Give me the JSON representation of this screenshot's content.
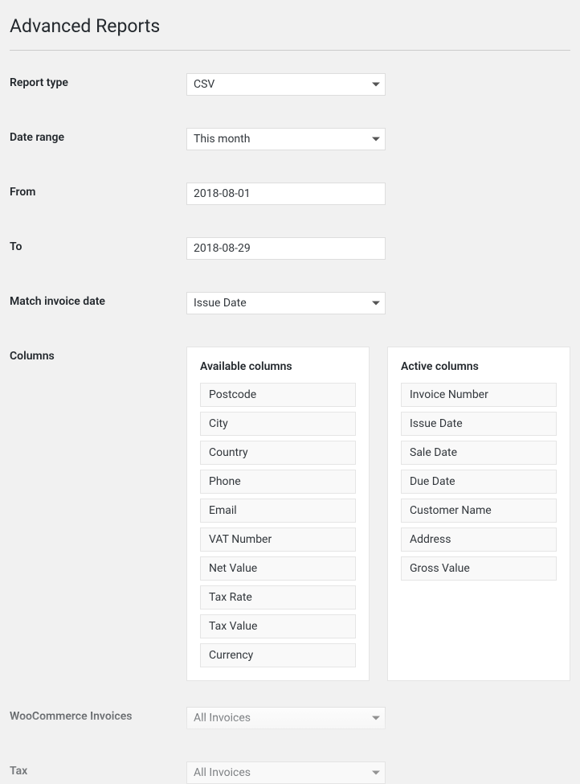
{
  "page_title": "Advanced Reports",
  "fields": {
    "report_type": {
      "label": "Report type",
      "value": "CSV"
    },
    "date_range": {
      "label": "Date range",
      "value": "This month"
    },
    "from": {
      "label": "From",
      "value": "2018-08-01"
    },
    "to": {
      "label": "To",
      "value": "2018-08-29"
    },
    "match_invoice_date": {
      "label": "Match invoice date",
      "value": "Issue Date"
    },
    "columns": {
      "label": "Columns"
    },
    "wc_invoices": {
      "label": "WooCommerce Invoices",
      "value": "All Invoices"
    },
    "tax": {
      "label": "Tax",
      "value": "All Invoices"
    }
  },
  "columns_panels": {
    "available": {
      "title": "Available columns",
      "items": [
        "Postcode",
        "City",
        "Country",
        "Phone",
        "Email",
        "VAT Number",
        "Net Value",
        "Tax Rate",
        "Tax Value",
        "Currency"
      ]
    },
    "active": {
      "title": "Active columns",
      "items": [
        "Invoice Number",
        "Issue Date",
        "Sale Date",
        "Due Date",
        "Customer Name",
        "Address",
        "Gross Value"
      ]
    }
  }
}
